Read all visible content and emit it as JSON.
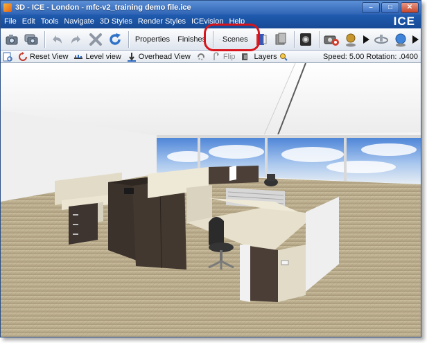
{
  "window": {
    "title": "3D - ICE - London - mfc-v2_training demo file.ice",
    "controls": [
      "minimize",
      "maximize",
      "close"
    ]
  },
  "menu": {
    "items": [
      "File",
      "Edit",
      "Tools",
      "Navigate",
      "3D Styles",
      "Render Styles",
      "ICEvision",
      "Help"
    ],
    "brand": "ICE"
  },
  "toolbar": {
    "properties_label": "Properties",
    "finishes_label": "Finishes",
    "scenes_label": "Scenes"
  },
  "toolbar2": {
    "reset_view": "Reset View",
    "level_view": "Level view",
    "overhead_view": "Overhead View",
    "flip": "Flip",
    "layers": "Layers",
    "speed_rotation": "Speed: 5.00 Rotation: .0400"
  },
  "colors": {
    "title_bar": "#2f64b5",
    "menu_bar": "#174a95",
    "highlight": "#d8141b",
    "ceiling": "#f2f2f2",
    "carpet": "#b8a98c",
    "desk_surface": "#e6e0cf",
    "cabinet": "#3e3530"
  }
}
